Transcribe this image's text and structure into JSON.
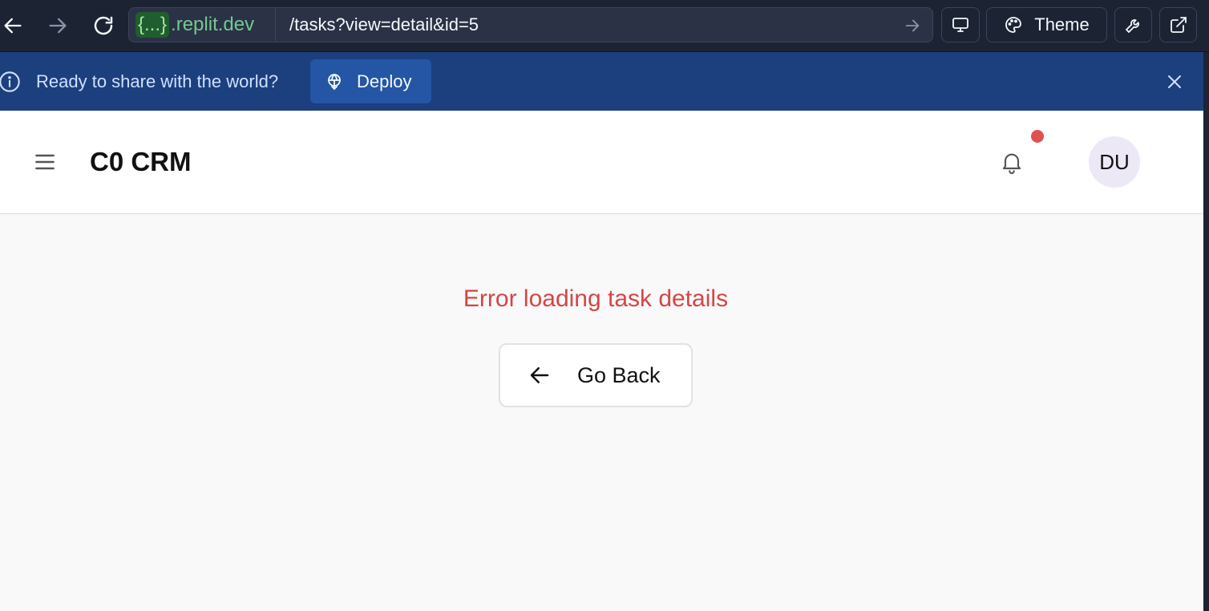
{
  "browser": {
    "domain_braces": "{...}",
    "domain": ".replit.dev",
    "url_path": "/tasks?view=detail&id=5",
    "theme_label": "Theme"
  },
  "banner": {
    "message": "Ready to share with the world?",
    "deploy_label": "Deploy",
    "bg_color": "#1c3f7e"
  },
  "app": {
    "title": "C0 CRM",
    "avatar_initials": "DU",
    "notification_dot_color": "#e05252"
  },
  "main": {
    "error_message": "Error loading task details",
    "error_color": "#d64545",
    "back_label": "Go Back"
  },
  "icons": [
    "arrow-left-icon",
    "arrow-right-icon",
    "reload-icon",
    "monitor-icon",
    "palette-icon",
    "wrench-icon",
    "external-link-icon",
    "info-icon",
    "deploy-icon",
    "close-icon",
    "menu-icon",
    "bell-icon"
  ]
}
